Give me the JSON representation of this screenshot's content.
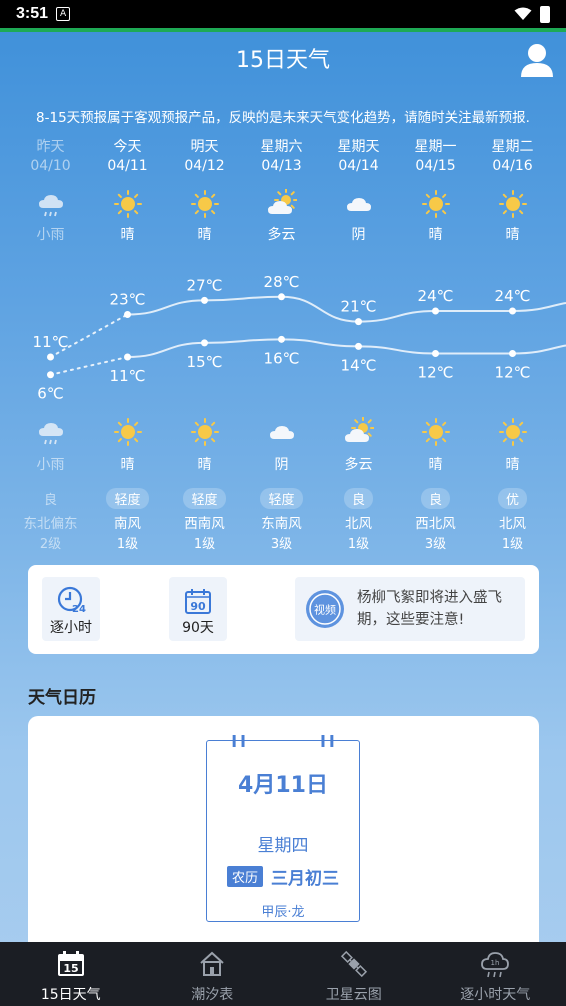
{
  "status": {
    "time": "3:51"
  },
  "header": {
    "title": "15日天气"
  },
  "notice": "8-15天预报属于客观预报产品，反映的是未来天气变化趋势，请随时关注最新预报.",
  "days": [
    {
      "name": "昨天",
      "date": "04/10",
      "day_icon": "cloud-rain-icon",
      "day_cond": "小雨",
      "night_icon": "cloud-rain-icon",
      "night_cond": "小雨",
      "high": "11℃",
      "low": "6℃",
      "aqi": "良",
      "wind": "东北偏东",
      "wind_level": "2级",
      "past": true
    },
    {
      "name": "今天",
      "date": "04/11",
      "day_icon": "sun-icon",
      "day_cond": "晴",
      "night_icon": "sun-icon",
      "night_cond": "晴",
      "high": "23℃",
      "low": "11℃",
      "aqi": "轻度",
      "wind": "南风",
      "wind_level": "1级"
    },
    {
      "name": "明天",
      "date": "04/12",
      "day_icon": "sun-icon",
      "day_cond": "晴",
      "night_icon": "sun-icon",
      "night_cond": "晴",
      "high": "27℃",
      "low": "15℃",
      "aqi": "轻度",
      "wind": "西南风",
      "wind_level": "1级"
    },
    {
      "name": "星期六",
      "date": "04/13",
      "day_icon": "partly-cloudy-icon",
      "day_cond": "多云",
      "night_icon": "cloud-icon",
      "night_cond": "阴",
      "high": "28℃",
      "low": "16℃",
      "aqi": "轻度",
      "wind": "东南风",
      "wind_level": "3级"
    },
    {
      "name": "星期天",
      "date": "04/14",
      "day_icon": "cloud-icon",
      "day_cond": "阴",
      "night_icon": "partly-cloudy-icon",
      "night_cond": "多云",
      "high": "21℃",
      "low": "14℃",
      "aqi": "良",
      "wind": "北风",
      "wind_level": "1级"
    },
    {
      "name": "星期一",
      "date": "04/15",
      "day_icon": "sun-icon",
      "day_cond": "晴",
      "night_icon": "sun-icon",
      "night_cond": "晴",
      "high": "24℃",
      "low": "12℃",
      "aqi": "良",
      "wind": "西北风",
      "wind_level": "3级"
    },
    {
      "name": "星期二",
      "date": "04/16",
      "day_icon": "sun-icon",
      "day_cond": "晴",
      "night_icon": "sun-icon",
      "night_cond": "晴",
      "high": "24℃",
      "low": "12℃",
      "aqi": "优",
      "wind": "北风",
      "wind_level": "1级"
    }
  ],
  "chart_data": {
    "type": "line",
    "categories": [
      "04/10",
      "04/11",
      "04/12",
      "04/13",
      "04/14",
      "04/15",
      "04/16"
    ],
    "series": [
      {
        "values": [
          11,
          23,
          27,
          28,
          21,
          24,
          24
        ]
      },
      {
        "values": [
          6,
          11,
          15,
          16,
          14,
          12,
          12
        ]
      }
    ],
    "unit": "℃",
    "ylim": [
      0,
      35
    ]
  },
  "tools": {
    "hourly_label": "逐小时",
    "days90_label": "90天",
    "days90_num": "90",
    "hourly_num": "24",
    "news_text": "杨柳飞絮即将进入盛飞期，这些要注意!",
    "news_badge": "视频"
  },
  "calendar_section": {
    "title": "天气日历",
    "date": "4月11日",
    "weekday": "星期四",
    "lunar_tag": "农历",
    "lunar": "三月初三",
    "ganzhi": "甲辰·龙",
    "extra": "…"
  },
  "tabbar": {
    "tabs": [
      {
        "label": "15日天气",
        "icon": "calendar-15-icon",
        "num": "15"
      },
      {
        "label": "潮汐表",
        "icon": "house-icon"
      },
      {
        "label": "卫星云图",
        "icon": "satellite-icon"
      },
      {
        "label": "逐小时天气",
        "icon": "hourly-cloud-icon",
        "num": "1h"
      }
    ]
  },
  "colors": {
    "accent": "#4a7fd4",
    "sun": "#f7c948",
    "tab_bg": "#1b1e24"
  }
}
